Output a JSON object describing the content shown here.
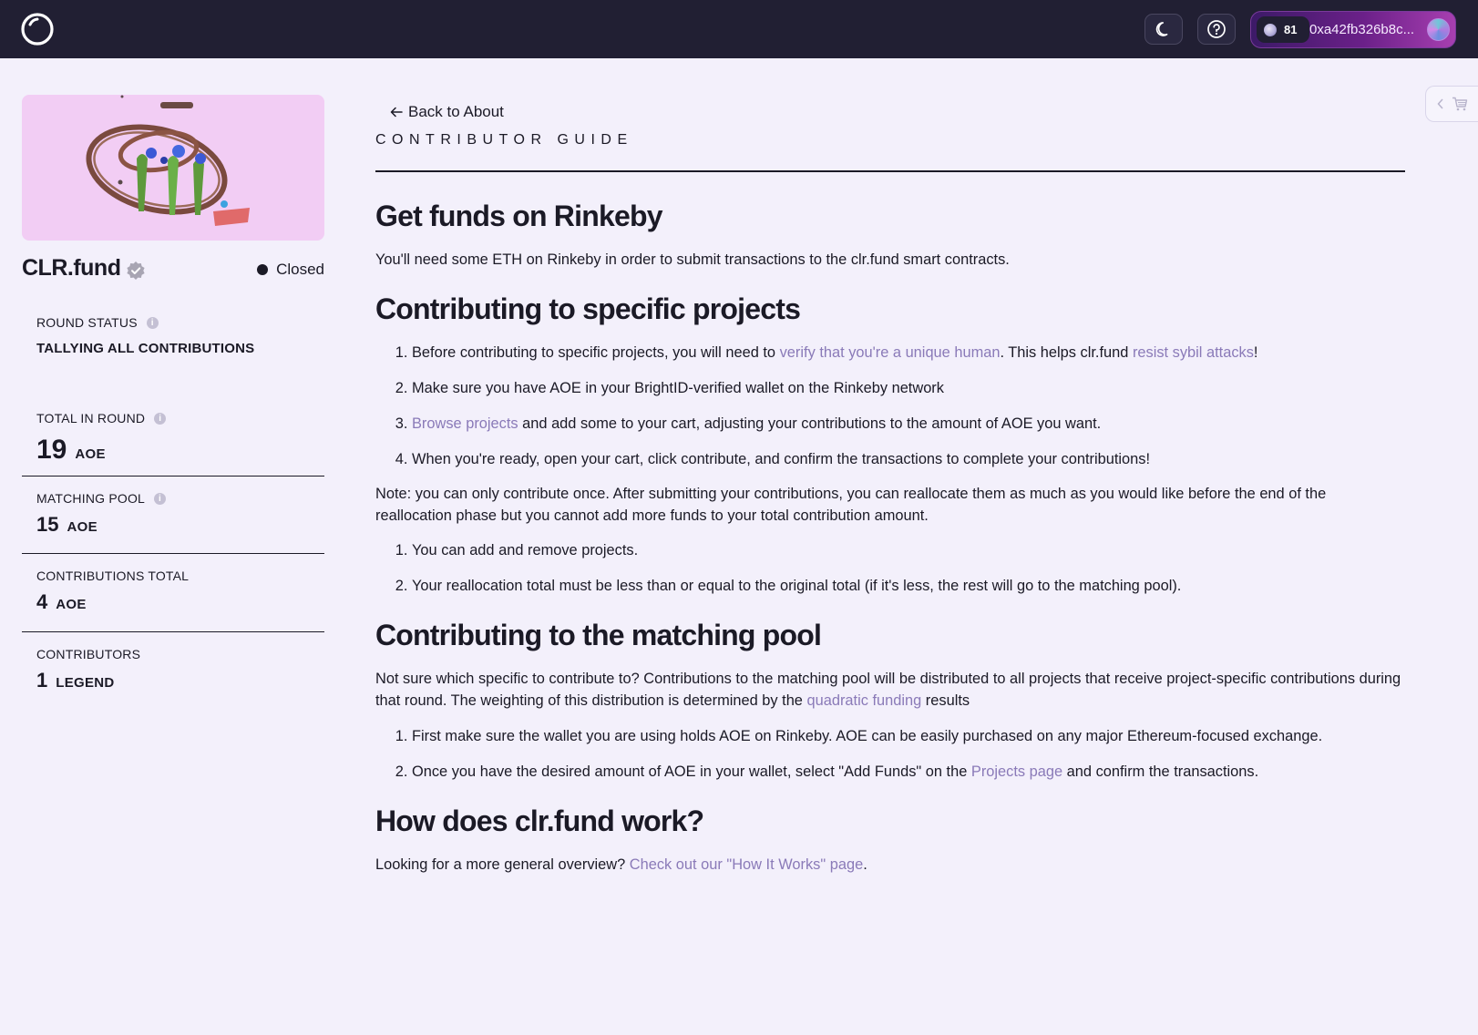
{
  "topbar": {
    "balance": "81",
    "wallet_address": "0xa42fb326b8c..."
  },
  "sidebar": {
    "round_name": "CLR.fund",
    "round_state": "Closed",
    "round_status_label": "ROUND STATUS",
    "round_status_value": "TALLYING ALL CONTRIBUTIONS",
    "stats": [
      {
        "label": "TOTAL IN ROUND",
        "value": "19",
        "unit": "AOE"
      },
      {
        "label": "MATCHING POOL",
        "value": "15",
        "unit": "AOE"
      },
      {
        "label": "CONTRIBUTIONS TOTAL",
        "value": "4",
        "unit": "AOE"
      },
      {
        "label": "CONTRIBUTORS",
        "value": "1",
        "unit": "LEGEND"
      }
    ]
  },
  "main": {
    "back_label": "Back to About",
    "eyebrow": "CONTRIBUTOR GUIDE",
    "s1": {
      "heading": "Get funds on Rinkeby",
      "text": "You'll need some ETH on Rinkeby in order to submit transactions to the clr.fund smart contracts."
    },
    "s2": {
      "heading": "Contributing to specific projects",
      "step1_a": "Before contributing to specific projects, you will need to ",
      "step1_link1": "verify that you're a unique human",
      "step1_b": ". This helps clr.fund ",
      "step1_link2": "resist sybil attacks",
      "step1_c": "!",
      "step2": "Make sure you have AOE in your BrightID-verified wallet on the Rinkeby network",
      "step3_link": "Browse projects",
      "step3_text": " and add some to your cart, adjusting your contributions to the amount of AOE you want.",
      "step4": "When you're ready, open your cart, click contribute, and confirm the transactions to complete your contributions!",
      "note": "Note: you can only contribute once. After submitting your contributions, you can reallocate them as much as you would like before the end of the reallocation phase but you cannot add more funds to your total contribution amount.",
      "sub1": "You can add and remove projects.",
      "sub2": "Your reallocation total must be less than or equal to the original total (if it's less, the rest will go to the matching pool)."
    },
    "s3": {
      "heading": "Contributing to the matching pool",
      "text_a": "Not sure which specific to contribute to? Contributions to the matching pool will be distributed to all projects that receive project-specific contributions during that round. The weighting of this distribution is determined by the ",
      "link": "quadratic funding",
      "text_b": " results",
      "step1": "First make sure the wallet you are using holds AOE on Rinkeby. AOE can be easily purchased on any major Ethereum-focused exchange.",
      "step2_a": "Once you have the desired amount of AOE in your wallet, select \"Add Funds\" on the ",
      "step2_link": "Projects page",
      "step2_b": " and confirm the transactions."
    },
    "s4": {
      "heading": "How does clr.fund work?",
      "text": "Looking for a more general overview? ",
      "link": "Check out our \"How It Works\" page",
      "end": "."
    }
  },
  "colors": {
    "topbar": "#211f33",
    "background": "#f3f0fb",
    "text": "#1b1a26",
    "link": "#8a7ab8",
    "wallet_gradient_start": "#3c1a67",
    "wallet_gradient_end": "#a73fb0"
  },
  "icons": [
    "logo-icon",
    "moon-icon",
    "help-icon",
    "cart-icon",
    "chevron-left-icon",
    "arrow-left-icon",
    "verified-icon",
    "info-icon"
  ]
}
